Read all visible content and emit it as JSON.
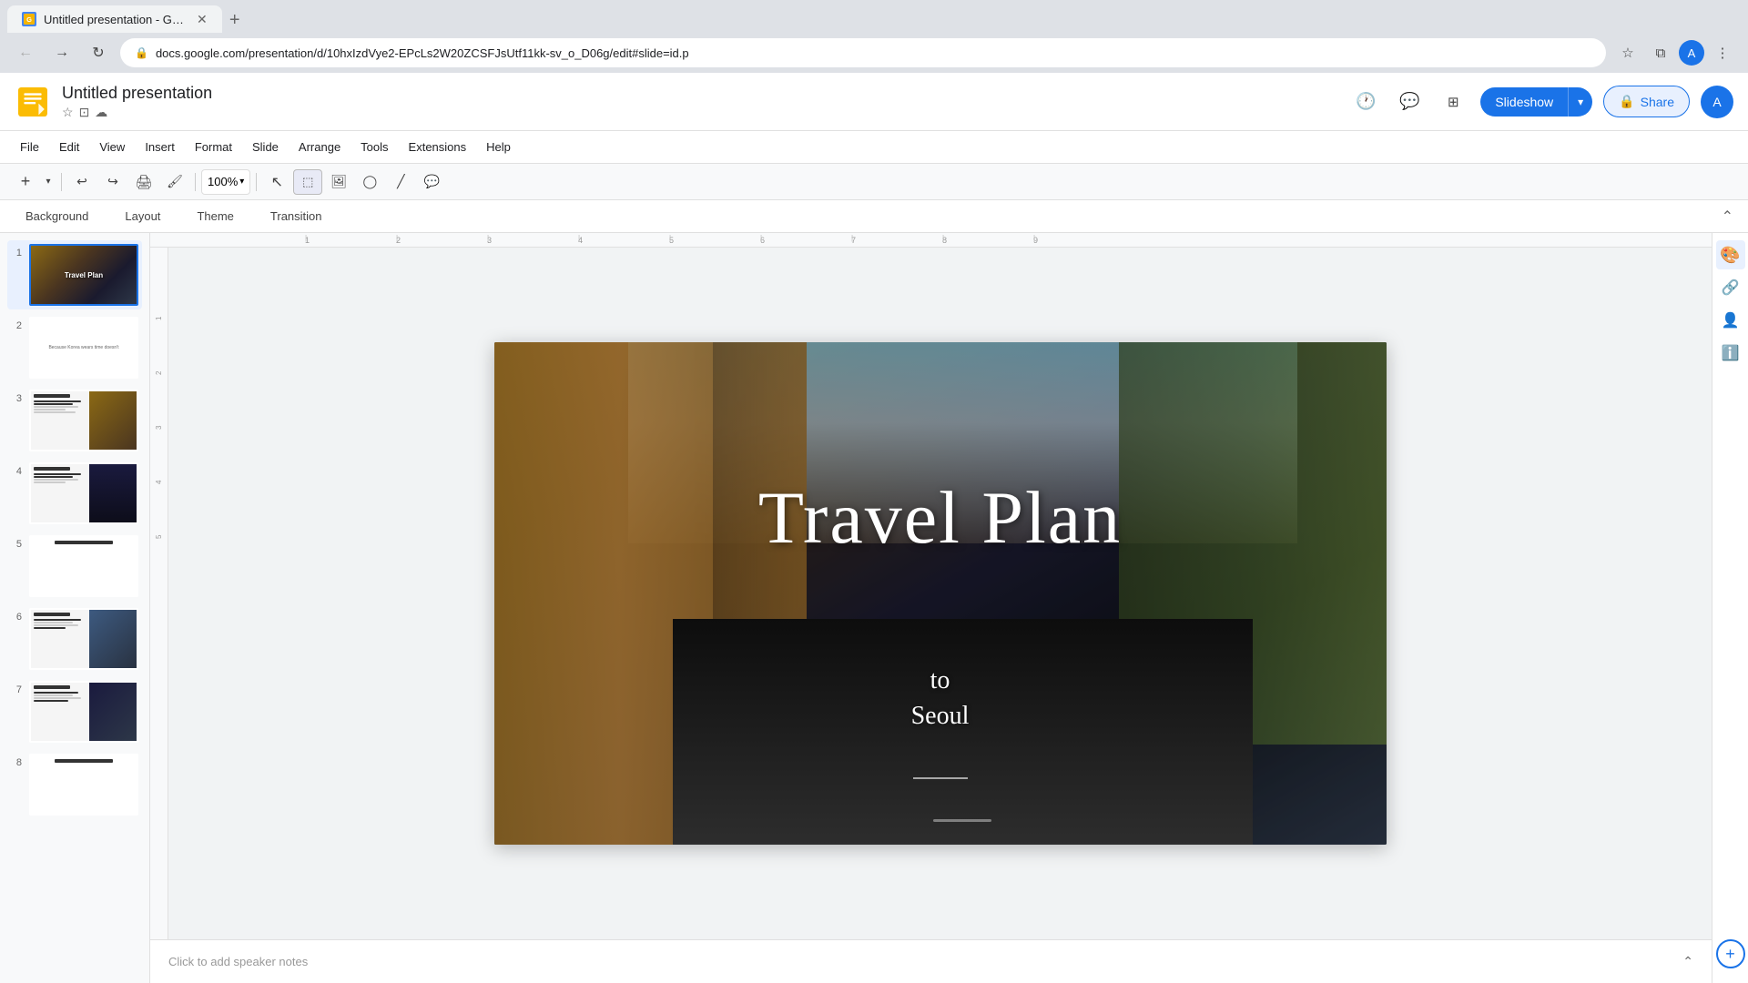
{
  "browser": {
    "tab_title": "Untitled presentation - Google ...",
    "tab_favicon": "G",
    "url": "docs.google.com/presentation/d/10hxIzdVye2-EPcLs2W20ZCSFJsUtf11kk-sv_o_D06g/edit#slide=id.p",
    "new_tab_label": "+"
  },
  "nav": {
    "back_label": "←",
    "forward_label": "→",
    "refresh_label": "↻",
    "bookmark_label": "☆",
    "extensions_label": "⧉",
    "more_label": "⋮"
  },
  "header": {
    "app_title": "Untitled presentation",
    "star_label": "☆",
    "drive_label": "⊡",
    "cloud_label": "☁",
    "history_label": "🕐",
    "comment_label": "💬",
    "view_label": "⊞",
    "slideshow_label": "Slideshow",
    "slideshow_dropdown": "▾",
    "share_label": "Share",
    "share_icon": "🔒",
    "avatar_label": "A"
  },
  "menu": {
    "items": [
      "File",
      "Edit",
      "View",
      "Insert",
      "Format",
      "Slide",
      "Arrange",
      "Tools",
      "Extensions",
      "Help"
    ]
  },
  "toolbar": {
    "add_label": "+",
    "undo_label": "↩",
    "redo_label": "↪",
    "print_label": "🖨",
    "paintformat_label": "🖌",
    "zoom_value": "100%",
    "cursor_label": "↖",
    "select_label": "⬚",
    "image_label": "🖼",
    "shape_label": "◯",
    "line_label": "╱",
    "comment_label": "💬"
  },
  "context_toolbar": {
    "background_label": "Background",
    "layout_label": "Layout",
    "theme_label": "Theme",
    "transition_label": "Transition"
  },
  "slides": [
    {
      "num": "1",
      "label": "Travel Plan slide"
    },
    {
      "num": "2",
      "label": "Text slide"
    },
    {
      "num": "3",
      "label": "Content slide with city image"
    },
    {
      "num": "4",
      "label": "Content slide with night city"
    },
    {
      "num": "5",
      "label": "Content slide"
    },
    {
      "num": "6",
      "label": "Content slide with temple"
    },
    {
      "num": "7",
      "label": "Content slide with night view"
    },
    {
      "num": "8",
      "label": "Content slide"
    }
  ],
  "main_slide": {
    "title": "Travel Plan",
    "subtitle_line1": "to",
    "subtitle_line2": "Seoul"
  },
  "ruler": {
    "marks": [
      "1",
      "2",
      "3",
      "4",
      "5",
      "6",
      "7",
      "8",
      "9"
    ]
  },
  "speaker_notes": {
    "placeholder": "Click to add speaker notes"
  },
  "right_sidebar": {
    "icons": [
      "palette",
      "link",
      "person",
      "info"
    ]
  }
}
